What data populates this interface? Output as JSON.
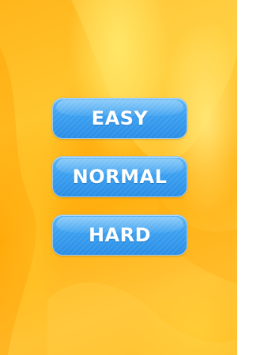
{
  "difficulty_menu": {
    "buttons": [
      {
        "id": "easy",
        "label": "EASY"
      },
      {
        "id": "normal",
        "label": "NORMAL"
      },
      {
        "id": "hard",
        "label": "HARD"
      }
    ]
  },
  "colors": {
    "background_primary": "#ffb61c",
    "background_highlight": "#ffe86e",
    "button_fill": "#3a9ff0",
    "button_border": "#9cc8ee",
    "button_text": "#ffffff"
  }
}
